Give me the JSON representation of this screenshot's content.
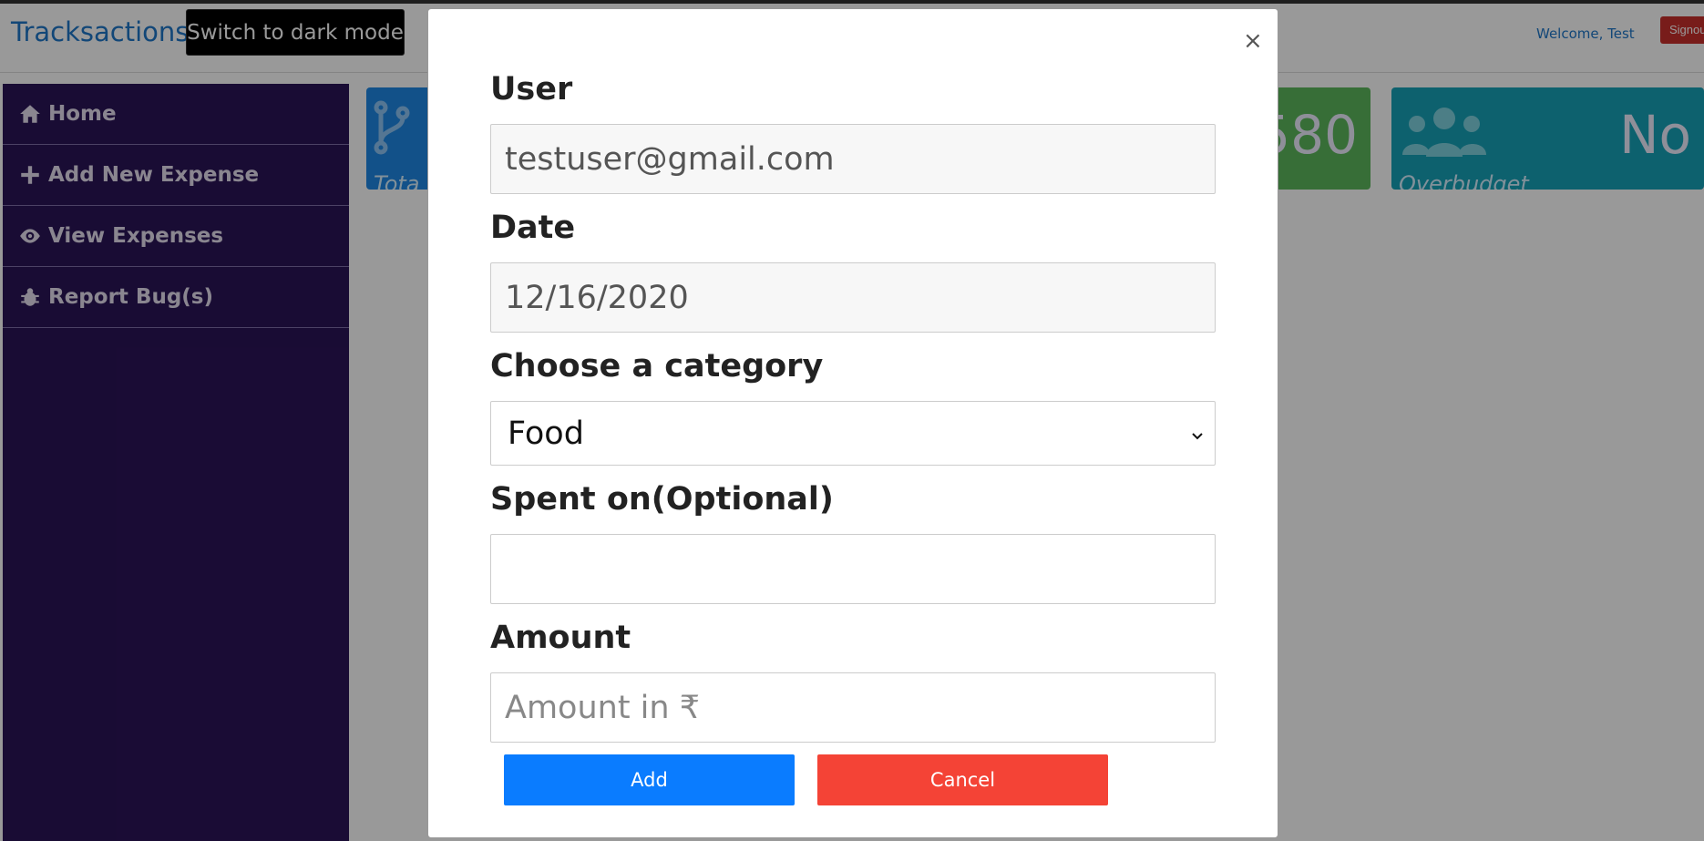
{
  "header": {
    "brand": "Tracksactions",
    "dark_mode_button": "Switch to dark mode",
    "welcome": "Welcome, Test",
    "signout": "Signout"
  },
  "sidebar": {
    "items": [
      {
        "label": "Home",
        "icon": "home-icon"
      },
      {
        "label": "Add New Expense",
        "icon": "plus-icon"
      },
      {
        "label": "View Expenses",
        "icon": "eye-icon"
      },
      {
        "label": "Report Bug(s)",
        "icon": "bug-icon"
      }
    ]
  },
  "cards": [
    {
      "label": "Tota",
      "value": "",
      "color": "#1e88e5",
      "icon": "branch-icon"
    },
    {
      "label": "",
      "value": "580",
      "color": "#5cb85c"
    },
    {
      "label": "Overbudget",
      "value": "No",
      "color": "#17a2b8",
      "icon": "users-icon"
    }
  ],
  "modal": {
    "close": "×",
    "user_label": "User",
    "user_value": "testuser@gmail.com",
    "date_label": "Date",
    "date_value": "12/16/2020",
    "category_label": "Choose a category",
    "category_value": "Food",
    "spent_on_label": "Spent on(Optional)",
    "spent_on_value": "",
    "amount_label": "Amount",
    "amount_placeholder": "Amount in ₹",
    "add_button": "Add",
    "cancel_button": "Cancel"
  },
  "colors": {
    "sidebar": "#2b1458",
    "brand": "#1f77c9",
    "add": "#0a7cff",
    "cancel": "#f44336"
  }
}
